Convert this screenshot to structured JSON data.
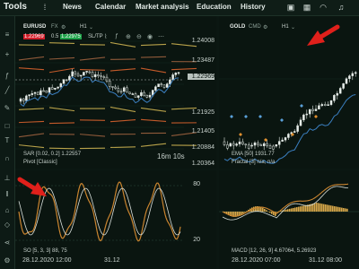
{
  "brand": "Tools",
  "nav": [
    "News",
    "Calendar",
    "Market analysis",
    "Education",
    "History"
  ],
  "top_icons": [
    "window-icon",
    "grid-icon",
    "wifi-icon",
    "bell-icon"
  ],
  "left_chart": {
    "symbol": "EURUSD",
    "suffix": "FX",
    "timeframe": "H1",
    "bid": "1.22969",
    "spread": "0.5",
    "ask": "1.22975",
    "sltp": "SL/TP",
    "price_ticks": [
      "1.24008",
      "1.23487",
      "1.22969",
      "1.21925",
      "1.21405",
      "1.20884",
      "1.20364"
    ],
    "current_price": "1.22969",
    "sar_label": "SAR [0.02, 0.2] 1.22557",
    "pivot_label": "Pivot [Classic]",
    "countdown": "16m 10s"
  },
  "left_osc": {
    "label": "SO [5, 3, 3] 88, 75",
    "ticks": [
      "80",
      "20"
    ],
    "dates": [
      "28.12.2020 12:00",
      "31.12"
    ]
  },
  "right_chart": {
    "symbol": "GOLD",
    "suffix": "CMD",
    "timeframe": "H1",
    "ema_label": "EMA [50] 1931.77",
    "fractal_label": "Fractal [3] n/a, n/a"
  },
  "right_osc": {
    "label": "MACD [12, 26, 9] 4.67064, 5.26923",
    "dates": [
      "28.12.2020 07:00",
      "31.12 08:00"
    ]
  },
  "colors": {
    "ask": "#1fa34a",
    "bid": "#d21f2b",
    "price_marker": "#b9c3be",
    "annotation": "#e0201b"
  }
}
